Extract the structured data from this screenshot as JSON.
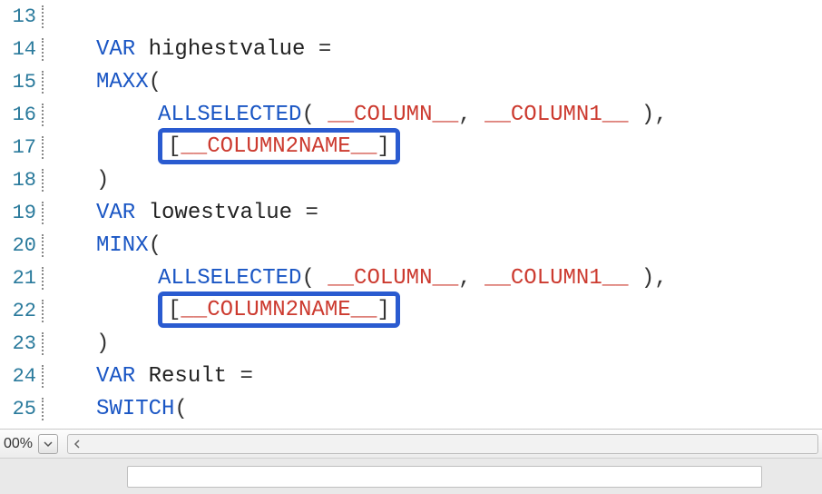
{
  "editor": {
    "lines": [
      {
        "num": "13",
        "indent": 1,
        "tokens": []
      },
      {
        "num": "14",
        "indent": 1,
        "tokens": [
          {
            "cls": "tok-kw",
            "t": "VAR"
          },
          {
            "cls": "tok-plain",
            "t": " highestvalue "
          },
          {
            "cls": "tok-punct",
            "t": "="
          }
        ]
      },
      {
        "num": "15",
        "indent": 1,
        "tokens": [
          {
            "cls": "tok-fn",
            "t": "MAXX"
          },
          {
            "cls": "tok-punct",
            "t": "("
          }
        ]
      },
      {
        "num": "16",
        "indent": 2,
        "tokens": [
          {
            "cls": "tok-fn",
            "t": "ALLSELECTED"
          },
          {
            "cls": "tok-punct",
            "t": "( "
          },
          {
            "cls": "tok-param",
            "t": "__COLUMN__"
          },
          {
            "cls": "tok-punct",
            "t": ", "
          },
          {
            "cls": "tok-param",
            "t": "__COLUMN1__"
          },
          {
            "cls": "tok-punct",
            "t": " ),"
          }
        ]
      },
      {
        "num": "17",
        "indent": 2,
        "highlight": true,
        "tokens": [
          {
            "cls": "tok-punct",
            "t": "["
          },
          {
            "cls": "tok-param",
            "t": "__COLUMN2NAME__"
          },
          {
            "cls": "tok-punct",
            "t": "]"
          }
        ]
      },
      {
        "num": "18",
        "indent": 1,
        "tokens": [
          {
            "cls": "tok-punct",
            "t": ")"
          }
        ]
      },
      {
        "num": "19",
        "indent": 1,
        "tokens": [
          {
            "cls": "tok-kw",
            "t": "VAR"
          },
          {
            "cls": "tok-plain",
            "t": " lowestvalue "
          },
          {
            "cls": "tok-punct",
            "t": "="
          }
        ]
      },
      {
        "num": "20",
        "indent": 1,
        "tokens": [
          {
            "cls": "tok-fn",
            "t": "MINX"
          },
          {
            "cls": "tok-punct",
            "t": "("
          }
        ]
      },
      {
        "num": "21",
        "indent": 2,
        "tokens": [
          {
            "cls": "tok-fn",
            "t": "ALLSELECTED"
          },
          {
            "cls": "tok-punct",
            "t": "( "
          },
          {
            "cls": "tok-param",
            "t": "__COLUMN__"
          },
          {
            "cls": "tok-punct",
            "t": ", "
          },
          {
            "cls": "tok-param",
            "t": "__COLUMN1__"
          },
          {
            "cls": "tok-punct",
            "t": " ),"
          }
        ]
      },
      {
        "num": "22",
        "indent": 2,
        "highlight": true,
        "tokens": [
          {
            "cls": "tok-punct",
            "t": "["
          },
          {
            "cls": "tok-param",
            "t": "__COLUMN2NAME__"
          },
          {
            "cls": "tok-punct",
            "t": "]"
          }
        ]
      },
      {
        "num": "23",
        "indent": 1,
        "tokens": [
          {
            "cls": "tok-punct",
            "t": ")"
          }
        ]
      },
      {
        "num": "24",
        "indent": 1,
        "tokens": [
          {
            "cls": "tok-kw",
            "t": "VAR"
          },
          {
            "cls": "tok-plain",
            "t": " Result "
          },
          {
            "cls": "tok-punct",
            "t": "="
          }
        ]
      },
      {
        "num": "25",
        "indent": 1,
        "tokens": [
          {
            "cls": "tok-fn",
            "t": "SWITCH"
          },
          {
            "cls": "tok-punct",
            "t": "("
          }
        ]
      }
    ]
  },
  "statusbar": {
    "zoom": "00%"
  }
}
